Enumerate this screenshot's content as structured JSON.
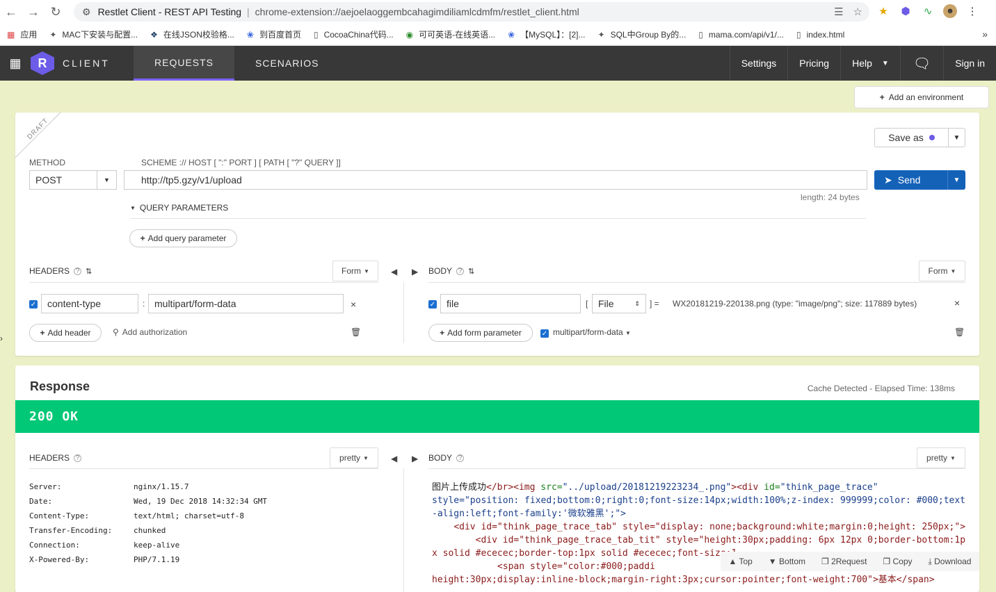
{
  "browser": {
    "tab_title": "Restlet Client - REST API Testing",
    "url": "chrome-extension://aejoelaoggembcahagimdiliamlcdmfm/restlet_client.html",
    "bookmarks": [
      {
        "label": "应用",
        "icon": "apps-icon"
      },
      {
        "label": "MAC下安装与配置...",
        "icon": "bookmark-icon"
      },
      {
        "label": "在线JSON校验格...",
        "icon": "json-icon"
      },
      {
        "label": "到百度首页",
        "icon": "baidu-icon"
      },
      {
        "label": "CocoaChina代码...",
        "icon": "page-icon"
      },
      {
        "label": "可可英语-在线英语...",
        "icon": "bookmark-icon"
      },
      {
        "label": "【MySQL】：[2]...",
        "icon": "baidu-icon"
      },
      {
        "label": "SQL中Group By的...",
        "icon": "bookmark-icon"
      },
      {
        "label": "mama.com/api/v1/...",
        "icon": "page-icon"
      },
      {
        "label": "index.html",
        "icon": "page-icon"
      }
    ]
  },
  "app": {
    "brand": "CLIENT",
    "logo_letter": "R",
    "tabs": [
      "REQUESTS",
      "SCENARIOS"
    ],
    "active_tab": "REQUESTS",
    "header_right": {
      "settings": "Settings",
      "pricing": "Pricing",
      "help": "Help",
      "sign_in": "Sign in"
    }
  },
  "env": {
    "add_label": "Add an environment"
  },
  "request": {
    "draft_label": "DRAFT",
    "method_label": "METHOD",
    "method": "POST",
    "scheme_label": "SCHEME :// HOST [ \":\" PORT ] [ PATH [ \"?\" QUERY ]]",
    "url": "http://tp5.gzy/v1/upload",
    "length_text": "length: 24 bytes",
    "save_as": "Save as",
    "send": "Send",
    "query_params_label": "QUERY PARAMETERS",
    "add_query_param": "Add query parameter",
    "headers_label": "HEADERS",
    "headers_mode": "Form",
    "header_key": "content-type",
    "header_value": "multipart/form-data",
    "add_header": "Add header",
    "add_authorization": "Add authorization",
    "body_label": "BODY",
    "body_mode": "Form",
    "body_key": "file",
    "body_type": "File",
    "body_file": "WX20181219-220138.png (type: \"image/png\"; size: 117889 bytes)",
    "add_form_param": "Add form parameter",
    "multipart_label": "multipart/form-data"
  },
  "response": {
    "title": "Response",
    "meta": "Cache Detected - Elapsed Time: 138ms",
    "status": "200 OK",
    "headers_label": "HEADERS",
    "headers_mode": "pretty",
    "body_label": "BODY",
    "body_mode": "pretty",
    "headers": [
      {
        "key": "Server:",
        "value": "nginx/1.15.7"
      },
      {
        "key": "Date:",
        "value": "Wed, 19 Dec 2018 14:32:34 GMT"
      },
      {
        "key": "Content-Type:",
        "value": "text/html; charset=utf-8"
      },
      {
        "key": "Transfer-Encoding:",
        "value": "chunked"
      },
      {
        "key": "Connection:",
        "value": "keep-alive"
      },
      {
        "key": "X-Powered-By:",
        "value": "PHP/7.1.19"
      }
    ],
    "body_line1_text": "图片上传成功",
    "body_line1_tag1": "</br><img ",
    "body_line1_attr": "src=",
    "body_line1_val": "\"../upload/20181219223234_.png\"",
    "body_line1_tag2": "><div ",
    "body_line1_attr2": "id=",
    "body_line1_val2": "\"think_page_trace\"",
    "body_line2": "style=\"position: fixed;bottom:0;right:0;font-size:14px;width:100%;z-index: 999999;color: #000;text-align:left;font-family:'微软雅黑';\">",
    "body_line3": "    <div id=\"think_page_trace_tab\" style=\"display: none;background:white;margin:0;height: 250px;\">",
    "body_line4": "        <div id=\"think_page_trace_tab_tit\" style=\"height:30px;padding: 6px 12px 0;border-bottom:1px solid #ececec;border-top:1px solid #ececec;font-size:1",
    "body_line5": "            <span style=\"color:#000;paddi",
    "body_line6": "height:30px;display:inline-block;margin-right:3px;cursor:pointer;font-weight:700\">基本</span>",
    "tools": [
      "Top",
      "Bottom",
      "2Request",
      "Copy",
      "Download"
    ]
  }
}
